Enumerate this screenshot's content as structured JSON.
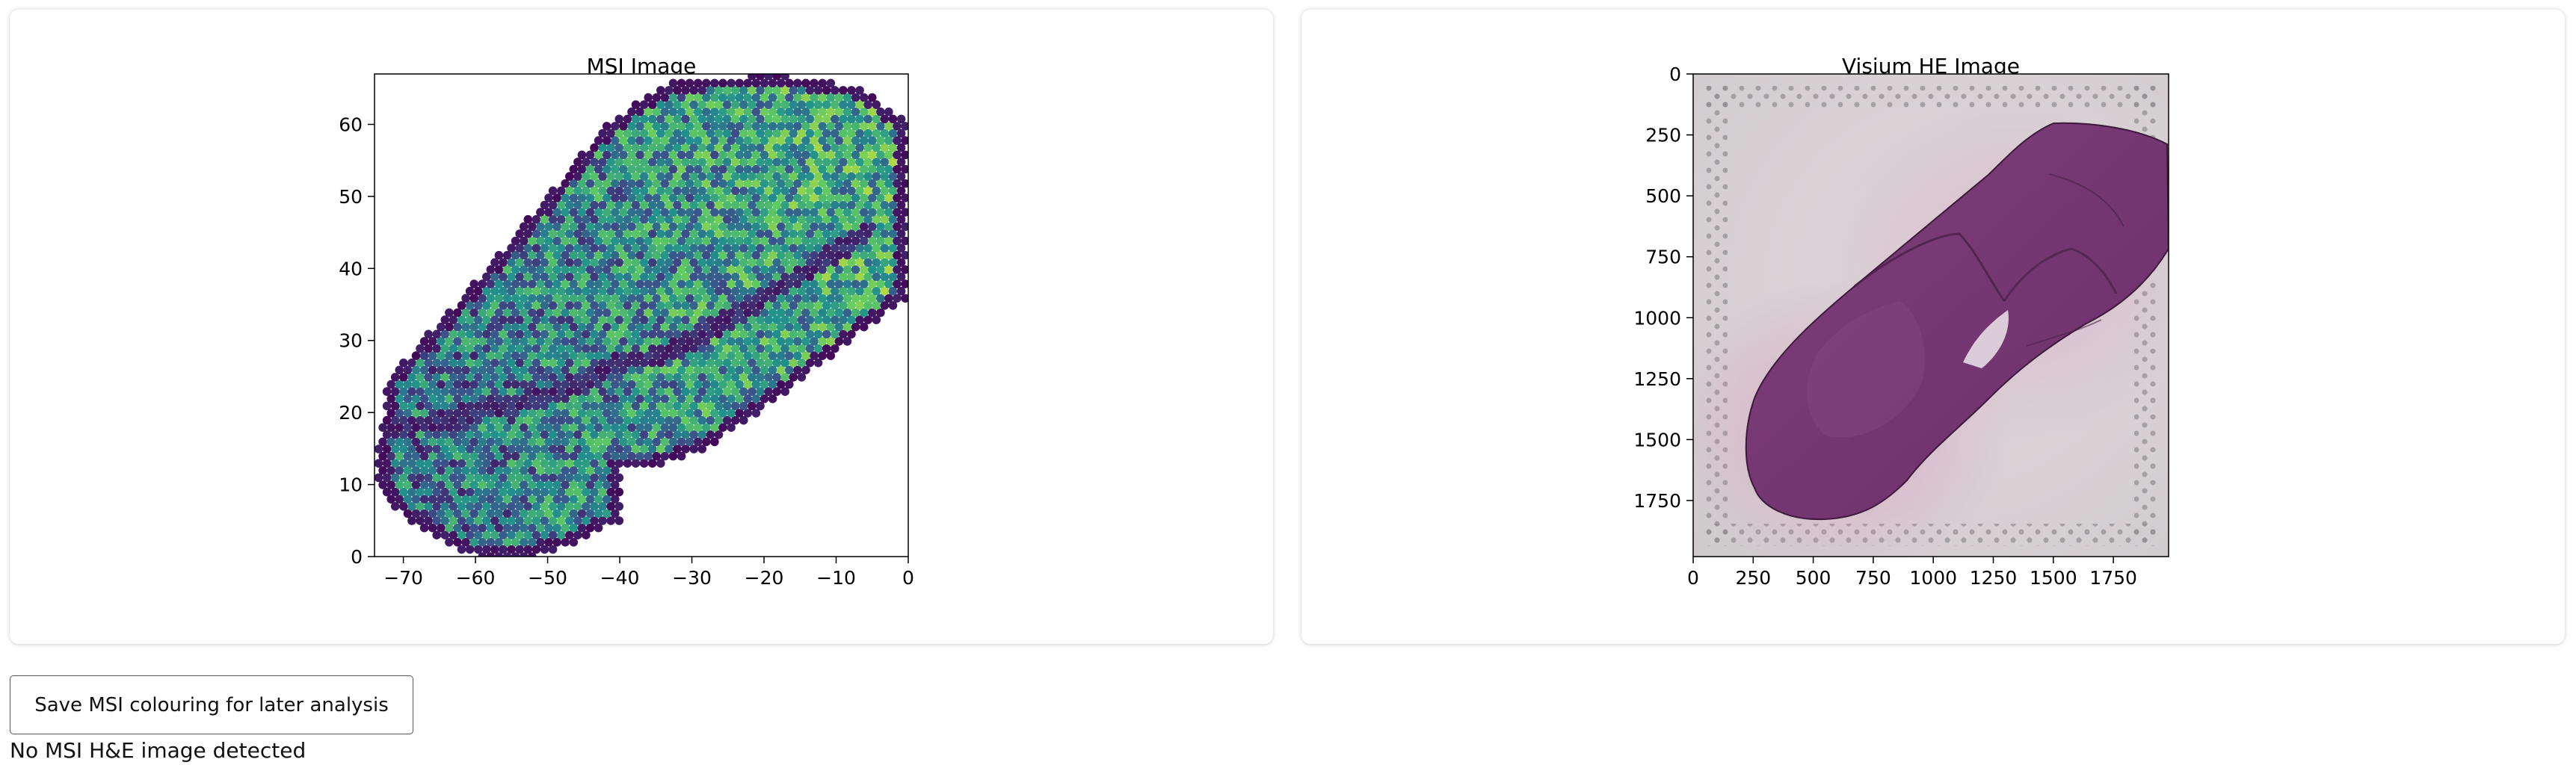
{
  "panels": [
    {
      "title": "MSI Image",
      "chart_data": {
        "type": "scatter",
        "title": "MSI Image",
        "xlabel": "",
        "ylabel": "",
        "xlim": [
          -74,
          0
        ],
        "ylim": [
          0,
          67
        ],
        "xticks": [
          -70,
          -60,
          -50,
          -40,
          -30,
          -20,
          -10,
          0
        ],
        "yticks": [
          0,
          10,
          20,
          30,
          40,
          50,
          60
        ],
        "colormap": "viridis",
        "colorbar": false,
        "shape": "tissue section: diagonal band from lower-left to upper-right with a notch at lower right",
        "marker": "hexagonal spots, spacing about 1 unit",
        "features": "dark purple border on tissue edge and a curved dark purple band through the middle; yellow-green speckles densest on the right"
      }
    },
    {
      "title": "Visium HE Image",
      "chart_data": {
        "type": "heatmap",
        "title": "Visium HE Image",
        "xlabel": "",
        "ylabel": "",
        "xlim": [
          0,
          1980
        ],
        "ylim": [
          1980,
          0
        ],
        "xticks": [
          0,
          250,
          500,
          750,
          1000,
          1250,
          1500,
          1750
        ],
        "yticks": [
          0,
          250,
          500,
          750,
          1000,
          1250,
          1500,
          1750
        ],
        "content": "H&E stained brain tissue section on grey slide with fiducial spot frame"
      }
    }
  ],
  "actions": {
    "save_label": "Save MSI colouring for later analysis"
  },
  "status": {
    "message": "No MSI H&E image detected"
  },
  "colors": {
    "viridis_low": "#440154",
    "viridis_mid": "#21918c",
    "viridis_high": "#fde725",
    "tissue": "#7b3a78",
    "slide": "#d4d0d2"
  }
}
